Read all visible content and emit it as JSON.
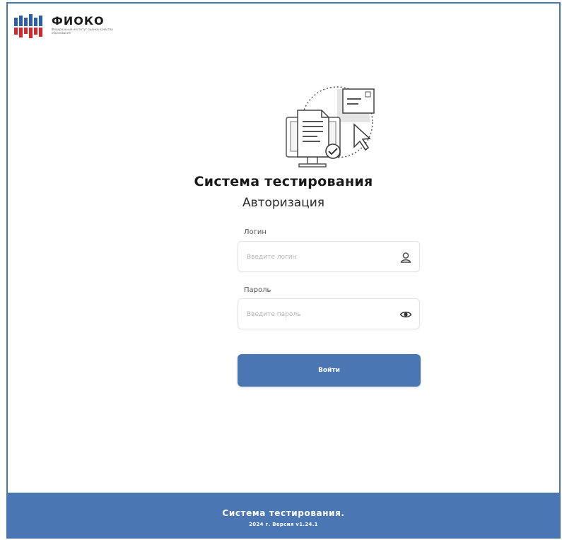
{
  "brand": {
    "name": "ФИОКО",
    "subtitle": "Федеральный институт оценки качества образования",
    "colors": {
      "red": "#d7262a",
      "blue": "#2d5ea8"
    }
  },
  "header": {
    "title": "Система тестирования",
    "subtitle": "Авторизация"
  },
  "form": {
    "login_label": "Логин",
    "login_placeholder": "Введите логин",
    "login_value": "",
    "login_icon": "user-icon",
    "password_label": "Пароль",
    "password_placeholder": "Введите пароль",
    "password_value": "",
    "password_icon": "eye-icon",
    "submit_label": "Войти"
  },
  "footer": {
    "title": "Система тестирования.",
    "version": "2024 г. Версия v1.24.1"
  },
  "theme": {
    "accent": "#4a76b3"
  }
}
